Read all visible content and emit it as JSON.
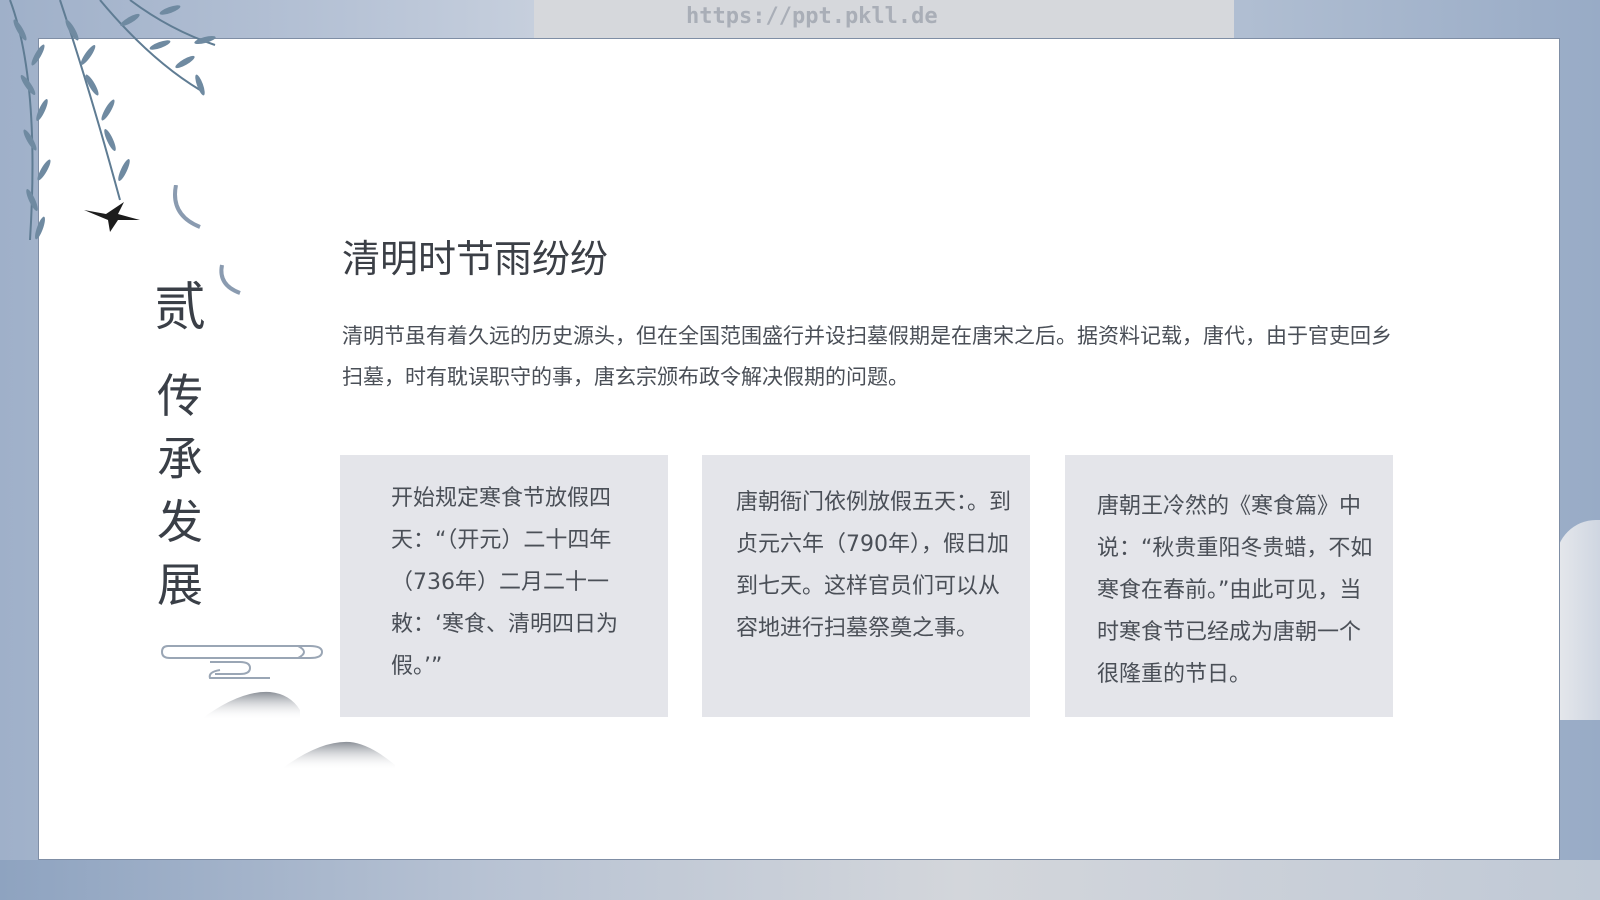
{
  "watermark": "https://ppt.pkll.de",
  "section": {
    "number": "贰",
    "title_chars": [
      "传",
      "承",
      "发",
      "展"
    ]
  },
  "title": "清明时节雨纷纷",
  "intro": "清明节虽有着久远的历史源头，但在全国范围盛行并设扫墓假期是在唐宋之后。据资料记载，唐代，由于官吏回乡扫墓，时有耽误职守的事，唐玄宗颁布政令解决假期的问题。",
  "cards": [
    {
      "text": "开始规定寒食节放假四天：“（开元）二十四年（736年）二月二十一敕：‘寒食、清明四日为假。’”"
    },
    {
      "text": "唐朝衙门依例放假五天：。到贞元六年（790年），假日加到七天。这样官员们可以从容地进行扫墓祭奠之事。"
    },
    {
      "text": "唐朝王冷然的《寒食篇》中说：“秋贵重阳冬贵蜡，不如寒食在春前。”由此可见，当时寒食节已经成为唐朝一个很隆重的节日。"
    }
  ],
  "colors": {
    "frame_bg": "#b7c3d6",
    "card_bg": "#e4e5ea",
    "text": "#4a4f57",
    "heading": "#3b3f46"
  },
  "icons": [
    "willow-branch-icon",
    "swallow-icon",
    "cloud-scroll-icon",
    "mountain-icon"
  ]
}
